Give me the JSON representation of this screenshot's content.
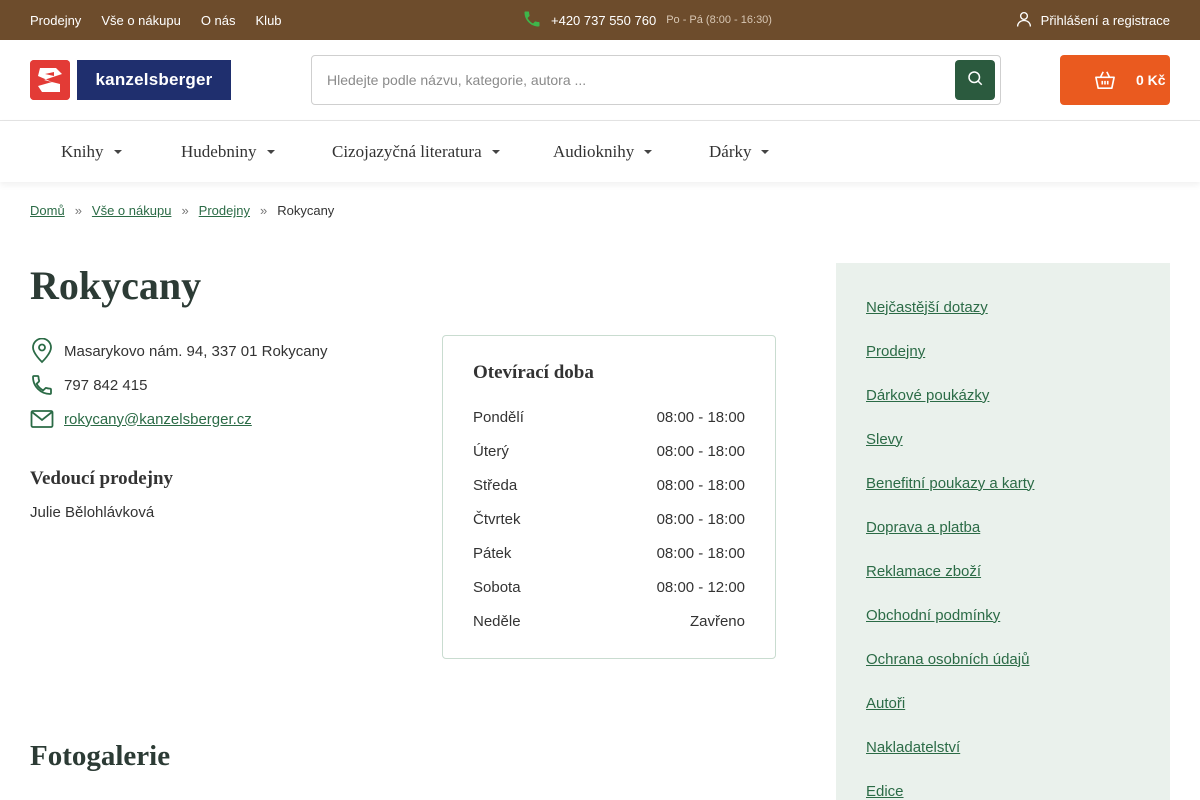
{
  "topbar": {
    "links": [
      "Prodejny",
      "Vše o nákupu",
      "O nás",
      "Klub"
    ],
    "phone": "+420 737 550 760",
    "hours": "Po - Pá (8:00 - 16:30)",
    "login": "Přihlášení a registrace"
  },
  "header": {
    "logo_text": "kanzelsberger",
    "search_placeholder": "Hledejte podle názvu, kategorie, autora ...",
    "cart_total": "0 Kč"
  },
  "nav": [
    "Knihy",
    "Hudebniny",
    "Cizojazyčná literatura",
    "Audioknihy",
    "Dárky"
  ],
  "breadcrumb": [
    "Domů",
    "Vše o nákupu",
    "Prodejny",
    "Rokycany"
  ],
  "breadcrumb_sep": "»",
  "store": {
    "title": "Rokycany",
    "address": "Masarykovo nám. 94, 337 01 Rokycany",
    "phone": "797 842 415",
    "email": "rokycany@kanzelsberger.cz",
    "manager_heading": "Vedoucí prodejny",
    "manager_name": "Julie Bělohlávková"
  },
  "hours": {
    "heading": "Otevírací doba",
    "rows": [
      {
        "day": "Pondělí",
        "time": "08:00 - 18:00"
      },
      {
        "day": "Úterý",
        "time": "08:00 - 18:00"
      },
      {
        "day": "Středa",
        "time": "08:00 - 18:00"
      },
      {
        "day": "Čtvrtek",
        "time": "08:00 - 18:00"
      },
      {
        "day": "Pátek",
        "time": "08:00 - 18:00"
      },
      {
        "day": "Sobota",
        "time": "08:00 - 12:00"
      },
      {
        "day": "Neděle",
        "time": "Zavřeno"
      }
    ]
  },
  "gallery_heading": "Fotogalerie",
  "sidebar": [
    "Nejčastější dotazy",
    "Prodejny",
    "Dárkové poukázky",
    "Slevy",
    "Benefitní poukazy a karty",
    "Doprava a platba",
    "Reklamace zboží",
    "Obchodní podmínky",
    "Ochrana osobních údajů",
    "Autoři",
    "Nakladatelství",
    "Edice"
  ],
  "colors": {
    "topbar": "#6d4c2c",
    "accent_green": "#2b5a3e",
    "cart_orange": "#ea5a1f",
    "logo_red": "#e33b36",
    "logo_navy": "#1f2f6e",
    "sidebar_bg": "#eaf1ec"
  }
}
